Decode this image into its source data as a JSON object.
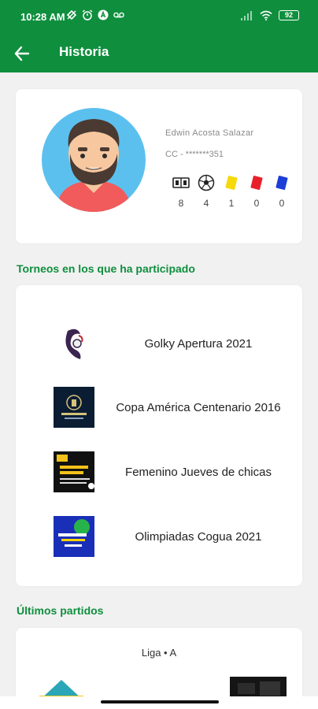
{
  "status_bar": {
    "time": "10:28 AM",
    "battery": "92"
  },
  "app_bar": {
    "title": "Historia",
    "back_icon": "arrow-left-icon"
  },
  "profile": {
    "name": "Edwin  Acosta Salazar",
    "document": "CC - *******351",
    "stats": [
      {
        "icon": "scoreboard-icon",
        "value": "8"
      },
      {
        "icon": "soccer-ball-icon",
        "value": "4"
      },
      {
        "icon": "yellow-card-icon",
        "value": "1",
        "color": "#f5d90a"
      },
      {
        "icon": "red-card-icon",
        "value": "0",
        "color": "#e8202a"
      },
      {
        "icon": "blue-card-icon",
        "value": "0",
        "color": "#1b3fd6"
      }
    ]
  },
  "tournaments_section": {
    "title": "Torneos en los que ha participado",
    "items": [
      {
        "name": "Golky Apertura 2021"
      },
      {
        "name": "Copa América Centenario 2016"
      },
      {
        "name": "Femenino Jueves de chicas"
      },
      {
        "name": "Olimpiadas Cogua 2021"
      }
    ]
  },
  "matches_section": {
    "title": "Últimos partidos",
    "league": "Liga • A"
  },
  "colors": {
    "primary": "#0f8f3e",
    "background": "#f1f1f1"
  }
}
